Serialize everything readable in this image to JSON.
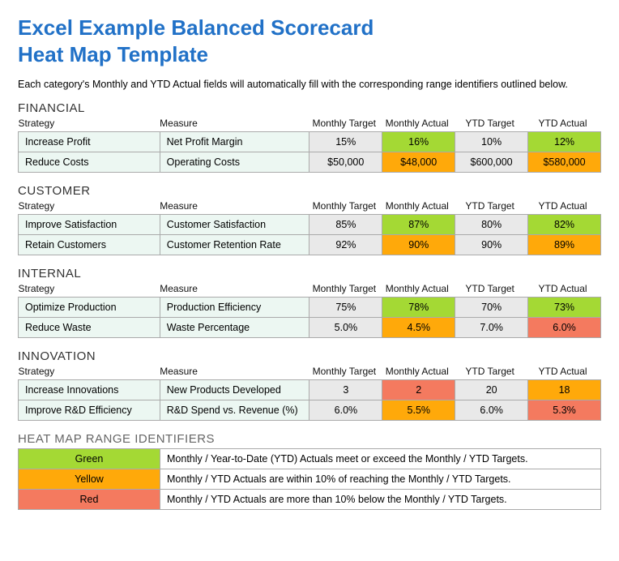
{
  "title_line1": "Excel Example Balanced Scorecard",
  "title_line2": "Heat Map Template",
  "subtitle": "Each category's Monthly and YTD Actual fields will automatically fill with the corresponding range identifiers outlined below.",
  "headers": {
    "strategy": "Strategy",
    "measure": "Measure",
    "monthly_target": "Monthly Target",
    "monthly_actual": "Monthly Actual",
    "ytd_target": "YTD Target",
    "ytd_actual": "YTD Actual"
  },
  "sections": [
    {
      "name": "FINANCIAL",
      "rows": [
        {
          "strategy": "Increase Profit",
          "measure": "Net Profit Margin",
          "mt": "15%",
          "ma": "16%",
          "ma_c": "green",
          "yt": "10%",
          "ya": "12%",
          "ya_c": "green"
        },
        {
          "strategy": "Reduce Costs",
          "measure": "Operating Costs",
          "mt": "$50,000",
          "ma": "$48,000",
          "ma_c": "yellow",
          "yt": "$600,000",
          "ya": "$580,000",
          "ya_c": "yellow"
        }
      ]
    },
    {
      "name": "CUSTOMER",
      "rows": [
        {
          "strategy": "Improve Satisfaction",
          "measure": "Customer Satisfaction",
          "mt": "85%",
          "ma": "87%",
          "ma_c": "green",
          "yt": "80%",
          "ya": "82%",
          "ya_c": "green"
        },
        {
          "strategy": "Retain Customers",
          "measure": "Customer Retention Rate",
          "mt": "92%",
          "ma": "90%",
          "ma_c": "yellow",
          "yt": "90%",
          "ya": "89%",
          "ya_c": "yellow"
        }
      ]
    },
    {
      "name": "INTERNAL",
      "rows": [
        {
          "strategy": "Optimize Production",
          "measure": "Production Efficiency",
          "mt": "75%",
          "ma": "78%",
          "ma_c": "green",
          "yt": "70%",
          "ya": "73%",
          "ya_c": "green"
        },
        {
          "strategy": "Reduce Waste",
          "measure": "Waste Percentage",
          "mt": "5.0%",
          "ma": "4.5%",
          "ma_c": "yellow",
          "yt": "7.0%",
          "ya": "6.0%",
          "ya_c": "red"
        }
      ]
    },
    {
      "name": "INNOVATION",
      "rows": [
        {
          "strategy": "Increase Innovations",
          "measure": "New Products Developed",
          "mt": "3",
          "ma": "2",
          "ma_c": "red",
          "yt": "20",
          "ya": "18",
          "ya_c": "yellow"
        },
        {
          "strategy": "Improve R&D Efficiency",
          "measure": "R&D Spend vs. Revenue (%)",
          "mt": "6.0%",
          "ma": "5.5%",
          "ma_c": "yellow",
          "yt": "6.0%",
          "ya": "5.3%",
          "ya_c": "red"
        }
      ]
    }
  ],
  "legend": {
    "title": "HEAT MAP RANGE IDENTIFIERS",
    "items": [
      {
        "label": "Green",
        "color": "green",
        "desc": "Monthly / Year-to-Date (YTD) Actuals meet or exceed the Monthly / YTD Targets."
      },
      {
        "label": "Yellow",
        "color": "yellow",
        "desc": "Monthly / YTD Actuals are within 10% of reaching the Monthly / YTD Targets."
      },
      {
        "label": "Red",
        "color": "red",
        "desc": "Monthly / YTD Actuals are more than 10% below the Monthly / YTD Targets."
      }
    ]
  }
}
